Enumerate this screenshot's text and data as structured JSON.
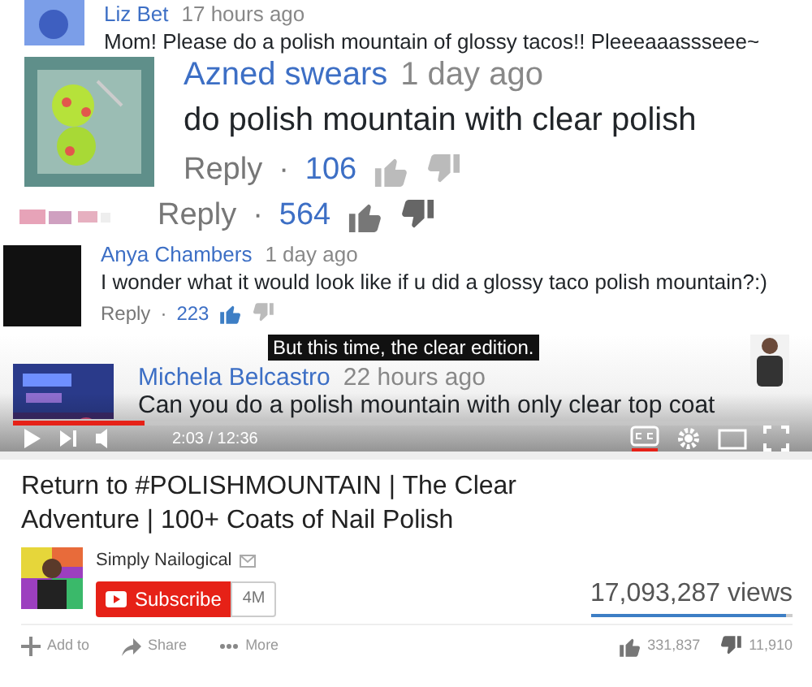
{
  "comments": [
    {
      "kind": "blue",
      "author": "Liz Bet",
      "time": "17 hours ago",
      "text": "Mom! Please do a polish mountain of glossy tacos!! Pleeeaaassseee~"
    },
    {
      "author": "Azned swears",
      "time": "1 day ago",
      "text": "do polish mountain with clear polish",
      "reply": "Reply",
      "dot": "·",
      "likes": "106",
      "liked": false
    },
    {
      "kind": "blurred",
      "reply": "Reply",
      "dot": "·",
      "likes": "564",
      "liked": false
    },
    {
      "kind": "dark",
      "author": "Anya Chambers",
      "time": "1 day ago",
      "text": "I wonder what it would look like if u did a glossy taco polish mountain?:)",
      "reply": "Reply",
      "dot": "·",
      "likes": "223",
      "liked": true
    }
  ],
  "player": {
    "caption": "But this time, the clear edition.",
    "author": "Michela Belcastro",
    "time": "22 hours ago",
    "text": "Can you do a polish mountain with only clear top coat",
    "level": 0.17,
    "time_display": "2:03 / 12:36",
    "captions_on": true
  },
  "video": {
    "title": "Return to #POLISHMOUNTAIN | The Clear Adventure | 100+ Coats of Nail Polish",
    "channel": "Simply Nailogical",
    "subscribe": "Subscribe",
    "subscribers": "4M",
    "views": "17,093,287 views",
    "level": 0.97,
    "actions": [
      {
        "kind": "add",
        "label": "Add to"
      },
      {
        "kind": "share",
        "label": "Share"
      },
      {
        "kind": "more",
        "label": "More"
      }
    ],
    "likes": "331,837",
    "dislikes": "11,910"
  }
}
